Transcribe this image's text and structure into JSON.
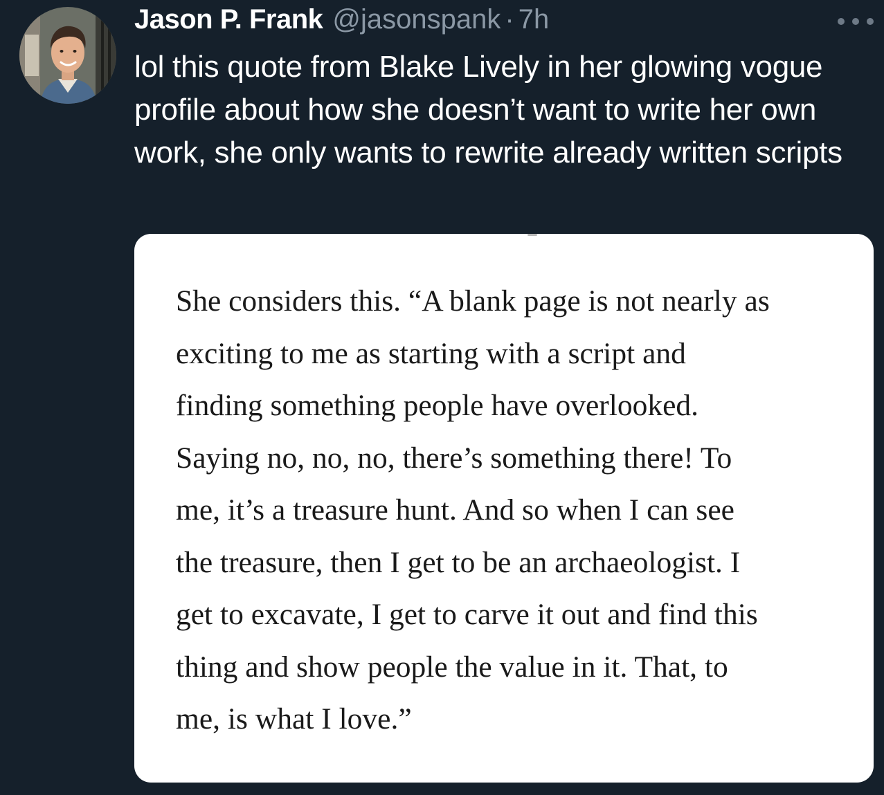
{
  "tweet": {
    "author": {
      "display_name": "Jason P. Frank",
      "handle": "@jasonspank",
      "separator": "·",
      "time": "7h",
      "avatar_icon": "profile-photo"
    },
    "more_icon": "more-options-icon",
    "text": "lol this quote from Blake Lively in her glowing vogue profile about how she doesn’t want to write her own work, she only wants to rewrite already written scripts",
    "media": {
      "quote_lines": [
        "She considers this. “A blank page is not nearly as",
        "exciting to me as starting with a script and",
        "finding something people have overlooked.",
        "Saying no, no, no, there’s something there! To",
        "me, it’s a treasure hunt. And so when I can see",
        "the treasure, then I get to be an archaeologist. I",
        "get to excavate, I get to carve it out and find this",
        "thing and show people the value in it. That, to",
        "me, is what I love.”"
      ]
    }
  },
  "colors": {
    "background": "#15202b",
    "primary_text": "#ffffff",
    "secondary_text": "#8b98a5",
    "card_background": "#ffffff",
    "quote_text": "#1a1a1a"
  }
}
